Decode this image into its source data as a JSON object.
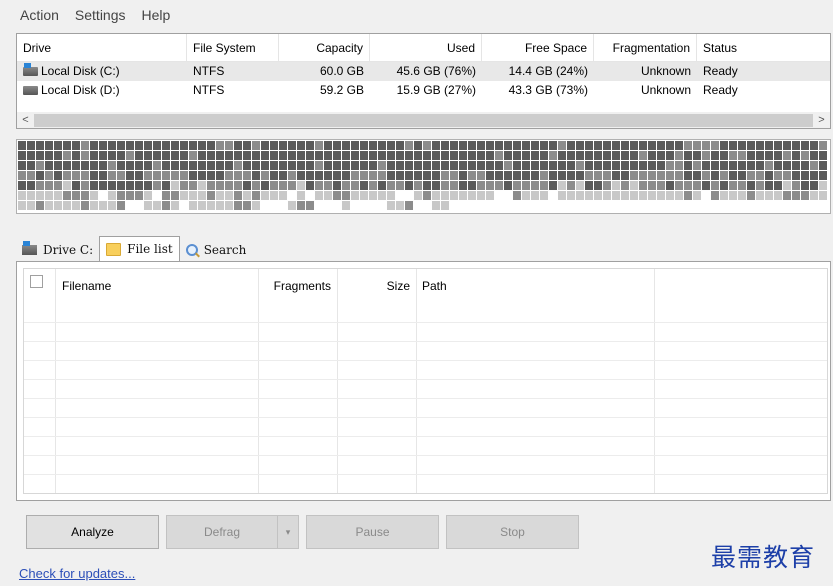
{
  "menu": [
    "Action",
    "Settings",
    "Help"
  ],
  "drives": {
    "headers": [
      "Drive",
      "File System",
      "Capacity",
      "Used",
      "Free Space",
      "Fragmentation",
      "Status"
    ],
    "rows": [
      {
        "name": "Local Disk (C:)",
        "fs": "NTFS",
        "capacity": "60.0 GB",
        "used": "45.6 GB (76%)",
        "free": "14.4 GB (24%)",
        "frag": "Unknown",
        "status": "Ready"
      },
      {
        "name": "Local Disk (D:)",
        "fs": "NTFS",
        "capacity": "59.2 GB",
        "used": "15.9 GB (27%)",
        "free": "43.3 GB (73%)",
        "frag": "Unknown",
        "status": "Ready"
      }
    ],
    "scroll_left": "<",
    "scroll_right": ">"
  },
  "tabs": [
    {
      "label": "Drive C:",
      "icon": "drive-icon"
    },
    {
      "label": "File list",
      "icon": "folder-icon"
    },
    {
      "label": "Search",
      "icon": "search-icon"
    }
  ],
  "file_list": {
    "headers": [
      "Filename",
      "Fragments",
      "Size",
      "Path"
    ]
  },
  "buttons": {
    "analyze": "Analyze",
    "defrag": "Defrag",
    "defrag_arrow": "▾",
    "pause": "Pause",
    "stop": "Stop"
  },
  "footer": {
    "update_link": "Check for updates..."
  },
  "watermark": "最需教育",
  "colors": {
    "cluster_dark": "#5a5a5a",
    "cluster_mid": "#8c8c8c",
    "cluster_light": "#c8c8c8",
    "cluster_free": "#ffffff",
    "link": "#2c4fb8"
  }
}
